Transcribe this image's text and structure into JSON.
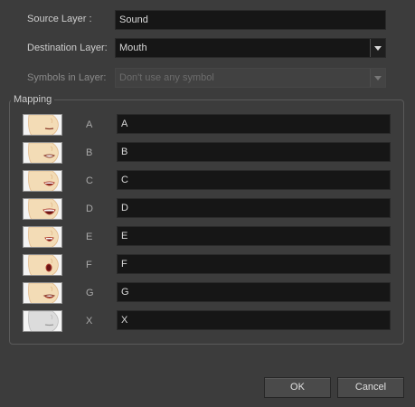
{
  "source_layer": {
    "label": "Source Layer :",
    "value": "Sound"
  },
  "destination_layer": {
    "label": "Destination Layer:",
    "value": "Mouth",
    "arrow_icon": "chevron-down-icon"
  },
  "symbols_in_layer": {
    "label": "Symbols in Layer:",
    "value": "Don't use any symbol",
    "disabled": true
  },
  "mapping": {
    "title": "Mapping",
    "rows": [
      {
        "phoneme": "A",
        "value": "A",
        "thumb_icon": "mouth-closed-icon"
      },
      {
        "phoneme": "B",
        "value": "B",
        "thumb_icon": "mouth-teeth-icon"
      },
      {
        "phoneme": "C",
        "value": "C",
        "thumb_icon": "mouth-open-slight-icon"
      },
      {
        "phoneme": "D",
        "value": "D",
        "thumb_icon": "mouth-open-wide-icon"
      },
      {
        "phoneme": "E",
        "value": "E",
        "thumb_icon": "mouth-e-icon"
      },
      {
        "phoneme": "F",
        "value": "F",
        "thumb_icon": "mouth-o-icon"
      },
      {
        "phoneme": "G",
        "value": "G",
        "thumb_icon": "mouth-f-icon"
      },
      {
        "phoneme": "X",
        "value": "X",
        "thumb_icon": "mouth-rest-grey-icon"
      }
    ]
  },
  "buttons": {
    "ok": "OK",
    "cancel": "Cancel"
  },
  "colors": {
    "background": "#3c3c3c",
    "field": "#161616",
    "skin": "#f3dcb6",
    "lips": "#c0503c"
  }
}
